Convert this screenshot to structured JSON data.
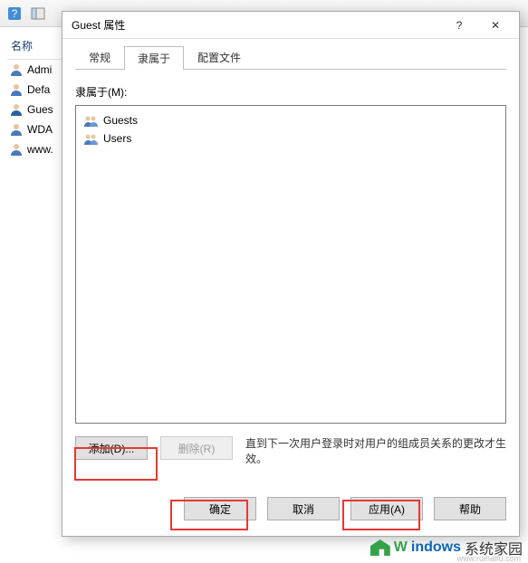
{
  "bg": {
    "list_header": "名称",
    "items": [
      {
        "label": "Admi"
      },
      {
        "label": "Defa"
      },
      {
        "label": "Gues"
      },
      {
        "label": "WDA"
      },
      {
        "label": "www."
      }
    ]
  },
  "dialog": {
    "title": "Guest 属性",
    "help_symbol": "?",
    "close_symbol": "✕",
    "tabs": {
      "general": "常规",
      "memberof": "隶属于",
      "profile": "配置文件"
    },
    "memberof": {
      "label": "隶属于(M):",
      "groups": [
        {
          "name": "Guests"
        },
        {
          "name": "Users"
        }
      ],
      "add_btn": "添加(D)...",
      "remove_btn": "删除(R)",
      "hint": "直到下一次用户登录时对用户的组成员关系的更改才生效。"
    },
    "footer": {
      "ok": "确定",
      "cancel": "取消",
      "apply": "应用(A)",
      "help": "帮助"
    }
  },
  "watermark": {
    "brand1": "indows",
    "brand2": "系统家园",
    "sub": "www.ruihaifu.com"
  }
}
